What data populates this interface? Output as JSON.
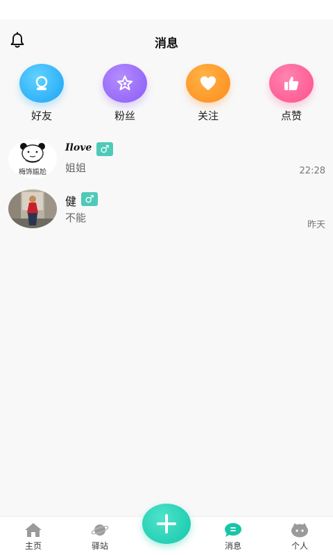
{
  "header": {
    "title": "消息"
  },
  "quick_actions": [
    {
      "label": "好友",
      "icon": "friend-icon",
      "color": "#1aa3f5"
    },
    {
      "label": "粉丝",
      "icon": "star-icon",
      "color": "#8a5cf6"
    },
    {
      "label": "关注",
      "icon": "heart-icon",
      "color": "#ff8a1a"
    },
    {
      "label": "点赞",
      "icon": "thumbs-up-icon",
      "color": "#ff4f8b"
    }
  ],
  "messages": [
    {
      "name": "Ilove",
      "gender": "♂",
      "preview": "姐姐",
      "time": "22:28",
      "avatar_caption": "梅饰尴尬"
    },
    {
      "name": "健",
      "gender": "♂",
      "preview": "不能",
      "time": "昨天"
    }
  ],
  "tabbar": {
    "items": [
      {
        "label": "主页",
        "icon": "home-icon"
      },
      {
        "label": "驿站",
        "icon": "planet-icon"
      },
      {
        "label": "消息",
        "icon": "message-icon",
        "active": true
      },
      {
        "label": "个人",
        "icon": "profile-icon"
      }
    ],
    "fab_icon": "plus-icon"
  },
  "colors": {
    "accent": "#13c7a9",
    "gender_badge": "#4fc9b8",
    "background": "#f8f8f8"
  }
}
